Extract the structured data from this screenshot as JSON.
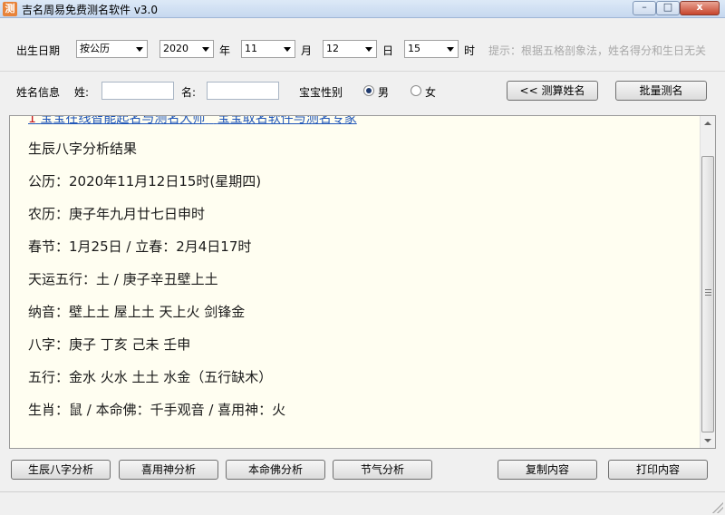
{
  "window": {
    "icon_glyph": "测",
    "title": "吉名周易免费测名软件 v3.0",
    "min_glyph": "–",
    "max_glyph": "□",
    "close_glyph": "x"
  },
  "birth": {
    "label": "出生日期",
    "calendar": "按公历",
    "year": "2020",
    "year_unit": "年",
    "month": "11",
    "month_unit": "月",
    "day": "12",
    "day_unit": "日",
    "hour": "15",
    "hour_unit": "时",
    "hint": "提示：根据五格剖象法，姓名得分和生日无关"
  },
  "name_row": {
    "label": "姓名信息",
    "surname_label": "姓:",
    "surname_value": "",
    "given_label": "名:",
    "given_value": "",
    "gender_label": "宝宝性别",
    "male": "男",
    "female": "女",
    "selected_gender": "男",
    "calc_button": "<< 测算姓名",
    "batch_button": "批量测名"
  },
  "content": {
    "ad_prefix": "1",
    "ad_text_1": "宝宝在线智能起名与测名大师",
    "ad_text_2": "宝宝取名软件与测名专家",
    "lines": [
      "生辰八字分析结果",
      "公历：2020年11月12日15时(星期四)",
      "农历：庚子年九月廿七日申时",
      "春节：1月25日 / 立春：2月4日17时",
      "天运五行：土 / 庚子辛丑壁上土",
      "纳音：壁上土 屋上土 天上火 剑锋金",
      "八字：庚子 丁亥 己未 壬申",
      "五行：金水 火水 土土 水金（五行缺木）",
      "生肖：鼠 / 本命佛：千手观音 / 喜用神：火"
    ]
  },
  "buttons": {
    "bazi": "生辰八字分析",
    "xiyong": "喜用神分析",
    "benming": "本命佛分析",
    "jieqi": "节气分析",
    "copy": "复制内容",
    "print": "打印内容"
  }
}
